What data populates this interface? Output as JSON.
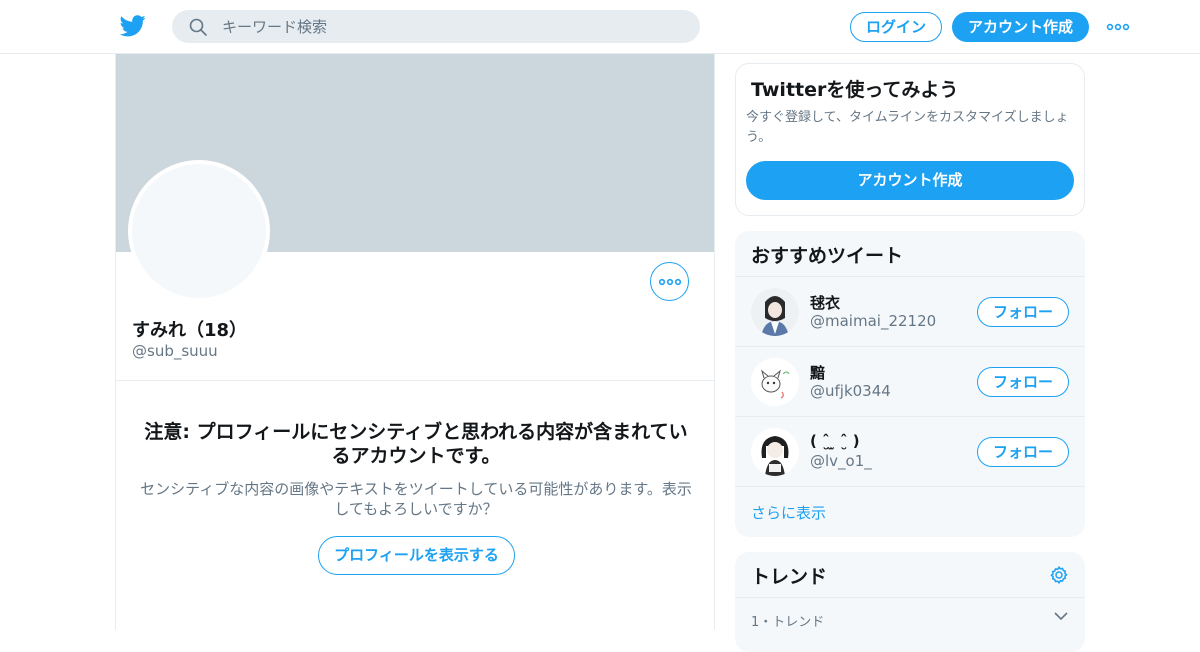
{
  "header": {
    "search_placeholder": "キーワード検索",
    "login_label": "ログイン",
    "signup_label": "アカウント作成",
    "brand_color": "#1da1f2"
  },
  "profile": {
    "name": "すみれ（18）",
    "handle": "@sub_suuu",
    "warning_title": "注意: プロフィールにセンシティブと思われる内容が含まれているアカウントです。",
    "warning_body": "センシティブな内容の画像やテキストをツイートしている可能性があります。表示してもよろしいですか？",
    "show_profile_label": "プロフィールを表示する"
  },
  "signup_card": {
    "title": "Twitterを使ってみよう",
    "text": "今すぐ登録して、タイムラインをカスタマイズしましょう。",
    "button_label": "アカウント作成"
  },
  "recommended": {
    "title": "おすすめツイート",
    "users": [
      {
        "name": "毬衣",
        "handle": "@maimai_22120",
        "follow_label": "フォロー"
      },
      {
        "name": "黯",
        "handle": "@ufjk0344",
        "follow_label": "フォロー"
      },
      {
        "name": "( ˆ̮ ̫ ˆ̮ )",
        "handle": "@lv_o1_",
        "follow_label": "フォロー"
      }
    ],
    "more_label": "さらに表示"
  },
  "trends": {
    "title": "トレンド",
    "first_meta": "1・トレンド"
  }
}
